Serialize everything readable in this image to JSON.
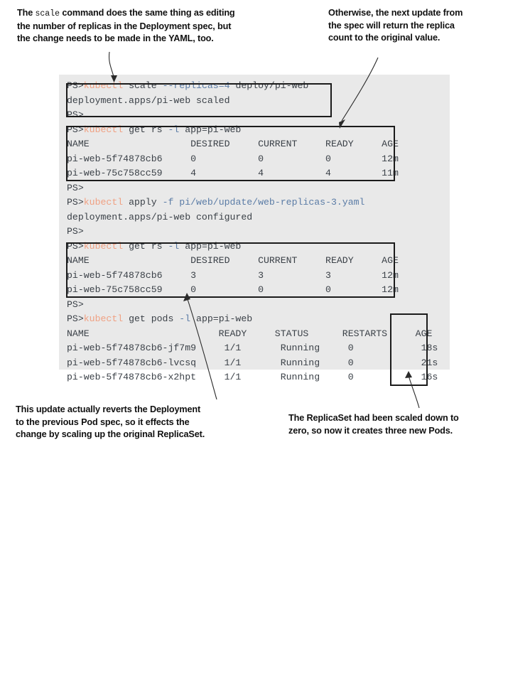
{
  "callouts": {
    "top_left": {
      "before": "The ",
      "mono": "scale",
      "after": " command does the same thing as editing\nthe number of replicas in the Deployment spec, but\nthe change needs to be made in the YAML, too."
    },
    "top_right": {
      "text": "Otherwise, the next update from\nthe spec will return the replica\ncount to the original value."
    },
    "bottom_left": {
      "text": "This update actually reverts the Deployment\nto the previous Pod spec, so it effects the\nchange by scaling up the original ReplicaSet."
    },
    "bottom_right": {
      "text": "The ReplicaSet had been scaled down to\nzero, so now it creates three new Pods."
    }
  },
  "terminal": {
    "prompt": "PS>",
    "colors": {
      "background": "#e9e9e9",
      "text": "#3b4148",
      "command": "#f0a183",
      "flag": "#5b7ca6",
      "box_border": "#1b1b1b"
    },
    "lines": [
      {
        "id": "l1",
        "prompt": "PS>",
        "command": "kubectl",
        "rest_plain": " scale ",
        "rest_flag": "--replicas=4",
        "rest_tail": " deploy/pi-web"
      },
      {
        "id": "l2",
        "text": "deployment.apps/pi-web scaled"
      },
      {
        "id": "l3",
        "prompt": "PS>",
        "text": ""
      },
      {
        "id": "l4",
        "prompt": "PS>",
        "command": "kubectl",
        "rest_plain": " get rs ",
        "rest_flag": "-l",
        "rest_tail": " app=pi-web"
      },
      {
        "id": "l5",
        "text": "NAME                  DESIRED     CURRENT     READY     AGE"
      },
      {
        "id": "l6",
        "text": "pi-web-5f74878cb6     0           0           0         12m"
      },
      {
        "id": "l7",
        "text": "pi-web-75c758cc59     4           4           4         11m"
      },
      {
        "id": "l8",
        "prompt": "PS>",
        "text": ""
      },
      {
        "id": "l9",
        "prompt": "PS>",
        "command": "kubectl",
        "rest_plain": " apply ",
        "rest_flag": "-f",
        "rest_tail": " pi/web/update/web-replicas-3.yaml"
      },
      {
        "id": "l10",
        "text": "deployment.apps/pi-web configured"
      },
      {
        "id": "l11",
        "prompt": "PS>",
        "text": ""
      },
      {
        "id": "l12",
        "prompt": "PS>",
        "command": "kubectl",
        "rest_plain": " get rs ",
        "rest_flag": "-l",
        "rest_tail": " app=pi-web"
      },
      {
        "id": "l13",
        "text": "NAME                  DESIRED     CURRENT     READY     AGE"
      },
      {
        "id": "l14",
        "text": "pi-web-5f74878cb6     3           3           3         12m"
      },
      {
        "id": "l15",
        "text": "pi-web-75c758cc59     0           0           0         12m"
      },
      {
        "id": "l16",
        "prompt": "PS>",
        "text": ""
      },
      {
        "id": "l17",
        "prompt": "PS>",
        "command": "kubectl",
        "rest_plain": " get pods ",
        "rest_flag": "-l",
        "rest_tail": " app=pi-web"
      },
      {
        "id": "l18",
        "text": "NAME                       READY     STATUS      RESTARTS     AGE"
      },
      {
        "id": "l19",
        "text": "pi-web-5f74878cb6-jf7m9     1/1       Running     0            18s"
      },
      {
        "id": "l20",
        "text": "pi-web-5f74878cb6-lvcsq     1/1       Running     0            21s"
      },
      {
        "id": "l21",
        "text": "pi-web-5f74878cb6-x2hpt     1/1       Running     0            16s"
      }
    ]
  }
}
